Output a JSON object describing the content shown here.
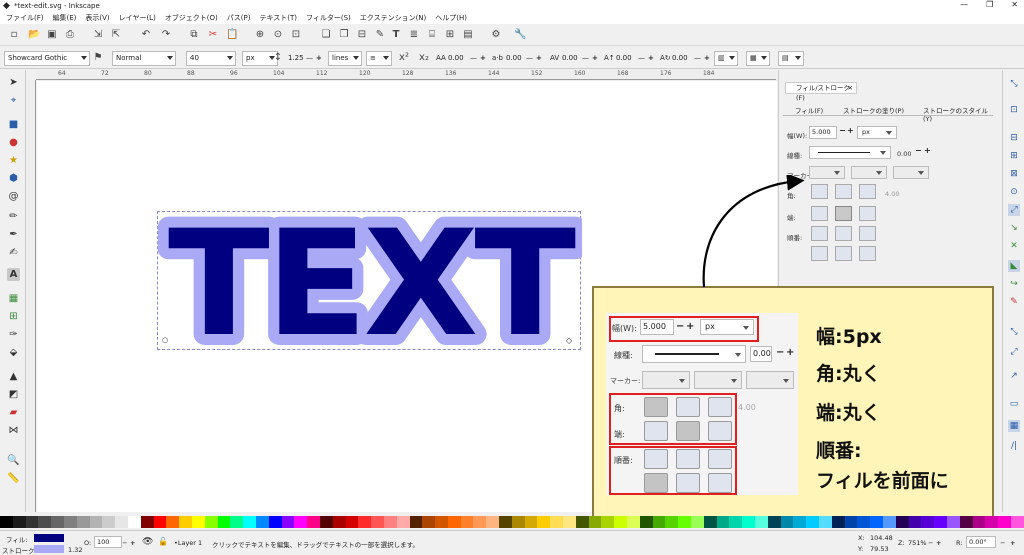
{
  "window": {
    "title": "*text-edit.svg - Inkscape",
    "controls": [
      "—",
      "❐",
      "✕"
    ]
  },
  "menubar": [
    "ファイル(F)",
    "編集(E)",
    "表示(V)",
    "レイヤー(L)",
    "オブジェクト(O)",
    "パス(P)",
    "テキスト(T)",
    "フィルター(S)",
    "エクステンション(N)",
    "ヘルプ(H)"
  ],
  "text_toolbar": {
    "font_family": "Showcard Gothic",
    "font_style": "Normal",
    "font_size": "40",
    "unit": "px",
    "line_spacing": "1.25",
    "line_unit": "lines",
    "letter_spacing": "0.00",
    "word_spacing": "0.00",
    "kerning": "0.00",
    "vertical_shift": "0.00",
    "rotation": "0.00"
  },
  "ruler_ticks": [
    "64",
    "72",
    "80",
    "88",
    "96",
    "104",
    "112",
    "120",
    "128",
    "136",
    "144",
    "152",
    "160",
    "168",
    "176",
    "184"
  ],
  "canvas_text": "TEXT",
  "colors": {
    "text_fill": "#000080",
    "text_stroke": "#a9a9f5",
    "callout_bg": "#fff5b8",
    "highlight": "#e02020"
  },
  "dock": {
    "tab_title": "フィル/ストローク(F)",
    "subtabs": [
      "フィル(F)",
      "ストロークの塗り(P)",
      "ストロークのスタイル(Y)"
    ],
    "width_label": "幅(W):",
    "width_value": "5.000",
    "width_unit": "px",
    "dash_label": "線種:",
    "dash_offset": "0.00",
    "marker_label": "マーカー:",
    "join_label": "角:",
    "miter_value": "4.00",
    "cap_label": "端:",
    "order_label": "順番:"
  },
  "callout": {
    "width_label": "幅(W):",
    "width_value": "5.000",
    "width_unit": "px",
    "dash_label": "線種:",
    "dash_offset": "0.00",
    "marker_label": "マーカー:",
    "join_label": "角:",
    "miter_value": "4.00",
    "cap_label": "端:",
    "order_label": "順番:",
    "notes": [
      "幅:5px",
      "角:丸く",
      "端:丸く",
      "順番:",
      "フィルを前面に"
    ]
  },
  "palette": [
    "#000000",
    "#1a1a1a",
    "#333333",
    "#4d4d4d",
    "#666666",
    "#808080",
    "#999999",
    "#b3b3b3",
    "#cccccc",
    "#e6e6e6",
    "#ffffff",
    "#800000",
    "#ff0000",
    "#ff6600",
    "#ffcc00",
    "#ffff00",
    "#88ff00",
    "#00ff00",
    "#00ff88",
    "#00ffff",
    "#0088ff",
    "#0000ff",
    "#8800ff",
    "#ff00ff",
    "#ff0088",
    "#550000",
    "#aa0000",
    "#d40000",
    "#ff2a2a",
    "#ff5555",
    "#ff8080",
    "#ffaaaa",
    "#552200",
    "#aa4400",
    "#d45500",
    "#ff6600",
    "#ff7f2a",
    "#ff9955",
    "#ffb380",
    "#554400",
    "#aa8800",
    "#d4aa00",
    "#ffcc00",
    "#ffdd55",
    "#ffe680",
    "#445500",
    "#88aa00",
    "#aad400",
    "#ccff00",
    "#ddff55",
    "#225500",
    "#44aa00",
    "#55d400",
    "#66ff00",
    "#99ff55",
    "#005544",
    "#00aa88",
    "#00d4aa",
    "#00ffcc",
    "#55ffdd",
    "#004455",
    "#0088aa",
    "#00aad4",
    "#00ccff",
    "#55ddff",
    "#002255",
    "#0044aa",
    "#0055d4",
    "#0066ff",
    "#5599ff",
    "#220055",
    "#4400aa",
    "#5500d4",
    "#6600ff",
    "#9955ff",
    "#550044",
    "#aa0088",
    "#d400aa",
    "#ff00cc",
    "#ff55dd"
  ],
  "status": {
    "fill_label": "フィル:",
    "stroke_label": "ストローク:",
    "stroke_width": "1.32",
    "opacity_label": "O:",
    "opacity": "100",
    "layer": "•Layer 1",
    "message": "クリックでテキストを編集、ドラッグでテキストの一部を選択します。",
    "x_label": "X:",
    "x": "104.48",
    "y_label": "Y:",
    "y": "79.53",
    "zoom_label": "Z:",
    "zoom": "751%",
    "rotate_label": "R:",
    "rotate": "0.00°"
  }
}
